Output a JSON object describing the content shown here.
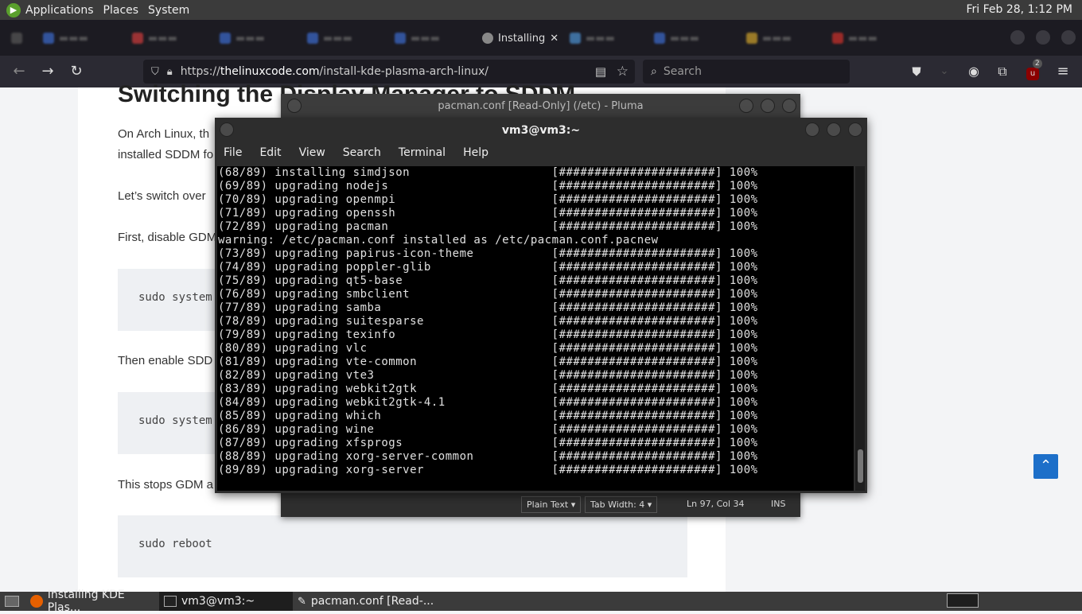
{
  "top_panel": {
    "menus": [
      "Applications",
      "Places",
      "System"
    ],
    "clock": "Fri Feb 28,  1:12 PM"
  },
  "browser": {
    "active_tab_label": "Installing",
    "url": {
      "scheme": "https://",
      "host": "thelinuxcode.com",
      "path": "/install-kde-plasma-arch-linux/"
    },
    "search_placeholder": "Search",
    "extension_badge": "2"
  },
  "article": {
    "heading": "Switching the Display Manager to SDDM",
    "paragraphs": [
      "On Arch Linux, th",
      "installed SDDM fo",
      "Let’s switch over",
      "First, disable GDM",
      "Then enable SDD",
      "This stops GDM a"
    ],
    "code_blocks": [
      "sudo system",
      "sudo system",
      "sudo reboot"
    ]
  },
  "pluma": {
    "title": "pacman.conf [Read-Only] (/etc) - Pluma",
    "status": {
      "syntax": "Plain Text",
      "tab_width": "Tab Width:  4",
      "position": "Ln 97, Col 34",
      "mode": "INS"
    }
  },
  "terminal": {
    "title": "vm3@vm3:~",
    "menu": [
      "File",
      "Edit",
      "View",
      "Search",
      "Terminal",
      "Help"
    ],
    "lines": [
      "(68/89) installing simdjson                    [######################] 100%",
      "(69/89) upgrading nodejs                       [######################] 100%",
      "(70/89) upgrading openmpi                      [######################] 100%",
      "(71/89) upgrading openssh                      [######################] 100%",
      "(72/89) upgrading pacman                       [######################] 100%",
      "warning: /etc/pacman.conf installed as /etc/pacman.conf.pacnew",
      "(73/89) upgrading papirus-icon-theme           [######################] 100%",
      "(74/89) upgrading poppler-glib                 [######################] 100%",
      "(75/89) upgrading qt5-base                     [######################] 100%",
      "(76/89) upgrading smbclient                    [######################] 100%",
      "(77/89) upgrading samba                        [######################] 100%",
      "(78/89) upgrading suitesparse                  [######################] 100%",
      "(79/89) upgrading texinfo                      [######################] 100%",
      "(80/89) upgrading vlc                          [######################] 100%",
      "(81/89) upgrading vte-common                   [######################] 100%",
      "(82/89) upgrading vte3                         [######################] 100%",
      "(83/89) upgrading webkit2gtk                   [######################] 100%",
      "(84/89) upgrading webkit2gtk-4.1               [######################] 100%",
      "(85/89) upgrading which                        [######################] 100%",
      "(86/89) upgrading wine                         [######################] 100%",
      "(87/89) upgrading xfsprogs                     [######################] 100%",
      "(88/89) upgrading xorg-server-common           [######################] 100%",
      "(89/89) upgrading xorg-server                  [######################] 100%"
    ]
  },
  "taskbar": {
    "tasks": [
      "Installing KDE Plas...",
      "vm3@vm3:~",
      "pacman.conf [Read-..."
    ]
  }
}
